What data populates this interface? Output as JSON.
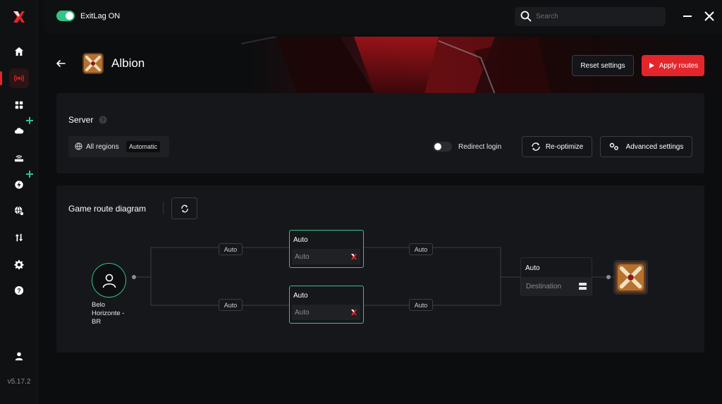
{
  "app": {
    "status_label": "ExitLag ON",
    "version": "v5.17.2"
  },
  "search": {
    "placeholder": "Search"
  },
  "sidebar": {
    "items": [
      {
        "icon": "home-icon"
      },
      {
        "icon": "routes-icon",
        "active": true
      },
      {
        "icon": "apps-icon"
      },
      {
        "icon": "cloud-gaming-icon",
        "badge": "plus"
      },
      {
        "icon": "router-icon"
      },
      {
        "icon": "boost-icon",
        "badge": "plus"
      },
      {
        "icon": "network-icon"
      },
      {
        "icon": "transfer-icon"
      },
      {
        "icon": "settings-icon"
      },
      {
        "icon": "help-icon"
      },
      {
        "icon": "profile-icon"
      }
    ]
  },
  "game": {
    "title": "Albion"
  },
  "header": {
    "reset_label": "Reset settings",
    "apply_label": "Apply routes"
  },
  "server": {
    "title": "Server",
    "region_label": "All regions",
    "region_mode": "Automatic",
    "redirect_label": "Redirect login",
    "reoptimize_label": "Re-optimize",
    "advanced_label": "Advanced settings"
  },
  "diagram": {
    "title": "Game route diagram",
    "user_location": "Belo Horizonte - BR",
    "links": [
      "Auto",
      "Auto",
      "Auto",
      "Auto"
    ],
    "nodes": [
      {
        "top": "Auto",
        "bottom": "Auto"
      },
      {
        "top": "Auto",
        "bottom": "Auto"
      }
    ],
    "destination": {
      "top": "Auto",
      "bottom": "Destination"
    }
  },
  "colors": {
    "accent": "#e3262b",
    "success": "#2fc58a",
    "panel": "#16171a"
  }
}
